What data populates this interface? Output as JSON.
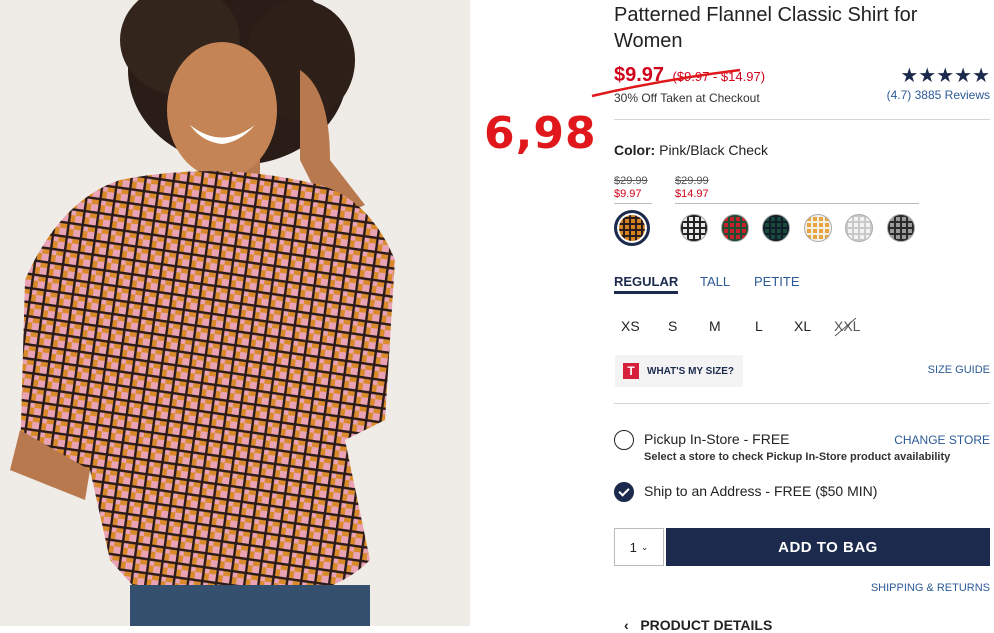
{
  "product": {
    "title": "Patterned Flannel Classic Shirt for Women",
    "sale_price": "$9.97",
    "price_range": "($9.97 - $14.97)",
    "promo_note": "30% Off Taken at Checkout",
    "rating_stars": "★★★★★",
    "reviews_text": "(4.7) 3885 Reviews",
    "rating_value": 4.7
  },
  "annotation": {
    "handwritten_price": "6,98",
    "color": "#e0181b"
  },
  "color_selector": {
    "label": "Color:",
    "value": "Pink/Black Check",
    "price_groups": [
      {
        "old": "$29.99",
        "new": "$9.97"
      },
      {
        "old": "$29.99",
        "new": "$14.97"
      }
    ],
    "swatches": [
      {
        "name": "orange-pink-check-swatch",
        "colors": [
          "#d4821f",
          "#2a1c1c"
        ],
        "selected": true
      },
      {
        "name": "black-white-check-swatch",
        "colors": [
          "#e8e8e8",
          "#222222"
        ],
        "selected": false
      },
      {
        "name": "red-green-plaid-swatch",
        "colors": [
          "#c8202a",
          "#1d4d33"
        ],
        "selected": false
      },
      {
        "name": "green-navy-plaid-swatch",
        "colors": [
          "#1c4a3a",
          "#0e1f2a"
        ],
        "selected": false
      },
      {
        "name": "orange-white-plaid-swatch",
        "colors": [
          "#e8a440",
          "#f4efe5"
        ],
        "selected": false
      },
      {
        "name": "white-grey-plaid-swatch",
        "colors": [
          "#f2f2f2",
          "#c9c9c9"
        ],
        "selected": false
      },
      {
        "name": "grey-black-check-swatch",
        "colors": [
          "#9a9a9a",
          "#2a2a2a"
        ],
        "selected": false
      }
    ]
  },
  "fit_tabs": [
    {
      "label": "REGULAR",
      "active": true
    },
    {
      "label": "TALL",
      "active": false
    },
    {
      "label": "PETITE",
      "active": false
    }
  ],
  "sizes": [
    {
      "label": "XS",
      "available": true
    },
    {
      "label": "S",
      "available": true
    },
    {
      "label": "M",
      "available": true
    },
    {
      "label": "L",
      "available": true
    },
    {
      "label": "XL",
      "available": true
    },
    {
      "label": "XXL",
      "available": false
    }
  ],
  "fit_helper": {
    "logo": "T",
    "label": "WHAT'S MY SIZE?",
    "size_guide": "SIZE GUIDE"
  },
  "fulfillment": {
    "pickup_label": "Pickup In-Store - FREE",
    "pickup_sub": "Select a store to check Pickup In-Store product availability",
    "change_store": "CHANGE STORE",
    "ship_label": "Ship to an Address - FREE ($50 MIN)"
  },
  "purchase": {
    "quantity": "1",
    "add_to_bag": "ADD TO BAG",
    "shipping_returns": "SHIPPING & RETURNS",
    "product_details": "PRODUCT DETAILS"
  },
  "colors": {
    "navy": "#1c2b4d",
    "link_blue": "#2d5a97",
    "sale_red": "#d0021b"
  }
}
